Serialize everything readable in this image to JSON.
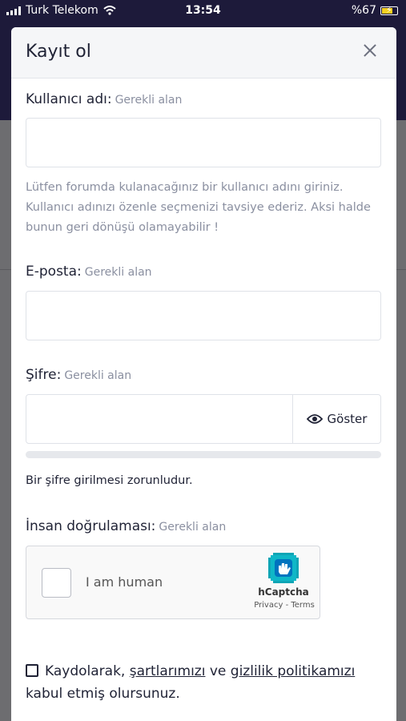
{
  "status_bar": {
    "carrier": "Turk Telekom",
    "time": "13:54",
    "battery": "%67"
  },
  "modal": {
    "title": "Kayıt ol"
  },
  "form": {
    "username": {
      "label": "Kullanıcı adı:",
      "required": "Gerekli alan",
      "value": "",
      "hint": "Lütfen forumda kulanacağınız bir kullanıcı adını giriniz. Kullanıcı adınızı özenle seçmenizi tavsiye ederiz. Aksi halde bunun geri dönüşü olamayabilir !"
    },
    "email": {
      "label": "E-posta:",
      "required": "Gerekli alan",
      "value": ""
    },
    "password": {
      "label": "Şifre:",
      "required": "Gerekli alan",
      "value": "",
      "show_label": "Göster",
      "error": "Bir şifre girilmesi zorunludur."
    },
    "captcha": {
      "label": "İnsan doğrulaması:",
      "required": "Gerekli alan",
      "checkbox_label": "I am human",
      "brand": "hCaptcha",
      "links": "Privacy - Terms"
    },
    "terms": {
      "prefix": "Kaydolarak,",
      "terms_link": "şartlarımızı",
      "middle": "ve",
      "privacy_link": "gizlilik politikamızı",
      "suffix": "kabul etmiş olursunuz."
    }
  },
  "icons": {
    "wifi": "wifi-icon",
    "battery": "battery-icon",
    "close": "close-icon",
    "eye": "eye-icon",
    "hcaptcha": "hcaptcha-logo-icon"
  },
  "colors": {
    "header_bg": "#1d1a3a",
    "text": "#1f2235",
    "muted": "#8a8fa0",
    "border": "#dfe2e8"
  }
}
